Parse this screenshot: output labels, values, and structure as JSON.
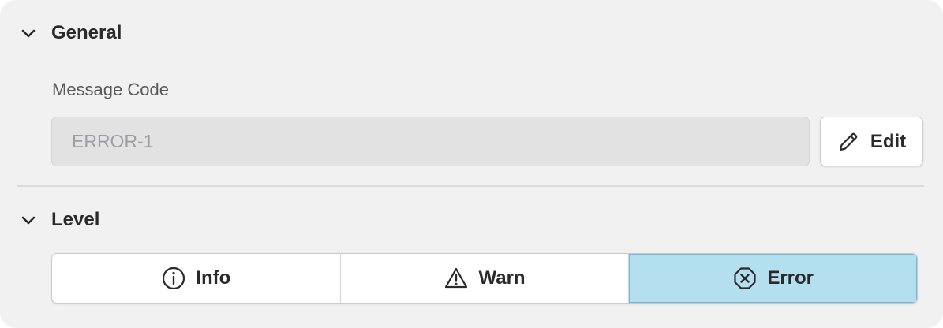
{
  "general": {
    "title": "General",
    "field_label": "Message Code",
    "message_code_value": "ERROR-1",
    "edit_label": "Edit"
  },
  "level": {
    "title": "Level",
    "options": [
      {
        "label": "Info",
        "icon": "info-circle-icon"
      },
      {
        "label": "Warn",
        "icon": "warning-triangle-icon"
      },
      {
        "label": "Error",
        "icon": "error-octagon-icon"
      }
    ],
    "selected": "Error"
  },
  "colors": {
    "selected_bg": "#b3dfef",
    "selected_border": "#6fb9d6",
    "panel_bg": "#f1f1f1",
    "input_bg": "#e2e2e3"
  }
}
